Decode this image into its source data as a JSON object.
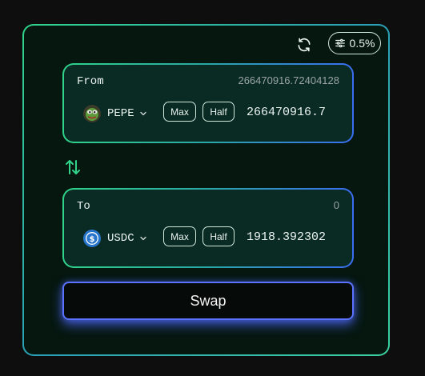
{
  "header": {
    "refresh_icon": "refresh-icon",
    "slippage_icon": "sliders-icon",
    "slippage_label": "0.5%"
  },
  "from": {
    "label": "From",
    "balance": "266470916.72404128",
    "token": {
      "symbol": "PEPE",
      "icon": "pepe-token-icon"
    },
    "max_label": "Max",
    "half_label": "Half",
    "amount": "266470916.7"
  },
  "switch_icon": "arrows-up-down-icon",
  "to": {
    "label": "To",
    "balance": "0",
    "token": {
      "symbol": "USDC",
      "icon": "usdc-token-icon"
    },
    "max_label": "Max",
    "half_label": "Half",
    "amount": "1918.392302"
  },
  "swap_label": "Swap",
  "colors": {
    "accent_green": "#2fd38a",
    "accent_blue": "#3a6df0",
    "swap_glow": "#5a72ff",
    "panel_bg": "#0a2a24",
    "card_bg": "#061710"
  }
}
